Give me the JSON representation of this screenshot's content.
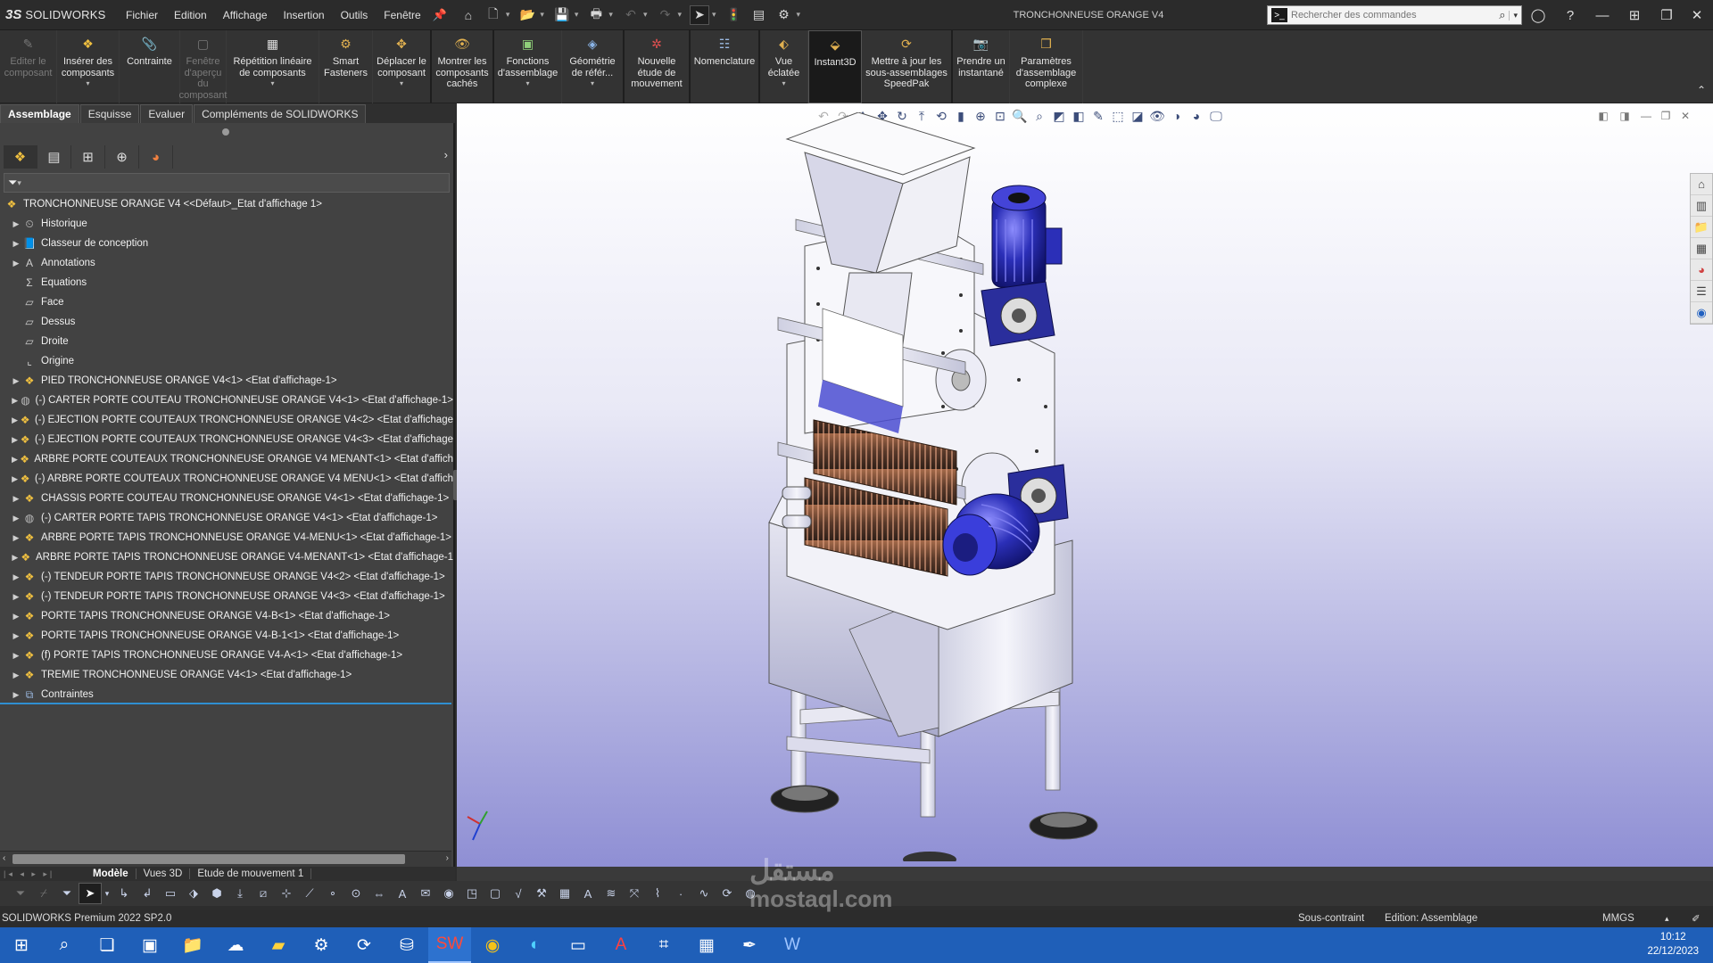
{
  "app": {
    "logo_mark": "3S",
    "logo_text": "SOLIDWORKS",
    "document_title": "TRONCHONNEUSE ORANGE V4"
  },
  "menu": [
    "Fichier",
    "Edition",
    "Affichage",
    "Insertion",
    "Outils",
    "Fenêtre"
  ],
  "search": {
    "placeholder": "Rechercher des commandes"
  },
  "ribbon": {
    "commands": [
      {
        "label": "Editer le composant",
        "icon": "edit-component-icon",
        "enabled": false
      },
      {
        "label": "Insérer des composants",
        "icon": "insert-components-icon",
        "enabled": true
      },
      {
        "label": "Contrainte",
        "icon": "mate-icon",
        "enabled": true
      },
      {
        "label": "Fenêtre d'aperçu du composant",
        "icon": "preview-window-icon",
        "enabled": false
      },
      {
        "label": "Répétition linéaire de composants",
        "icon": "linear-pattern-icon",
        "enabled": true
      },
      {
        "label": "Smart Fasteners",
        "icon": "smart-fasteners-icon",
        "enabled": true
      },
      {
        "label": "Déplacer le composant",
        "icon": "move-component-icon",
        "enabled": true
      },
      {
        "label": "Montrer les composants cachés",
        "icon": "show-hidden-icon",
        "enabled": true
      },
      {
        "label": "Fonctions d'assemblage",
        "icon": "assembly-features-icon",
        "enabled": true
      },
      {
        "label": "Géométrie de référ...",
        "icon": "reference-geometry-icon",
        "enabled": true
      },
      {
        "label": "Nouvelle étude de mouvement",
        "icon": "motion-study-icon",
        "enabled": true
      },
      {
        "label": "Nomenclature",
        "icon": "bom-icon",
        "enabled": true
      },
      {
        "label": "Vue éclatée",
        "icon": "exploded-view-icon",
        "enabled": true
      },
      {
        "label": "Instant3D",
        "icon": "instant3d-icon",
        "enabled": true,
        "active": true
      },
      {
        "label": "Mettre à jour les sous-assemblages SpeedPak",
        "icon": "speedpak-icon",
        "enabled": true
      },
      {
        "label": "Prendre un instantané",
        "icon": "snapshot-icon",
        "enabled": true
      },
      {
        "label": "Paramètres d'assemblage complexe",
        "icon": "large-assembly-icon",
        "enabled": true
      }
    ]
  },
  "tabs": [
    "Assemblage",
    "Esquisse",
    "Evaluer",
    "Compléments de SOLIDWORKS"
  ],
  "tree": {
    "root": "TRONCHONNEUSE ORANGE V4 <<Défaut>_Etat d'affichage 1>",
    "items": [
      {
        "label": "Historique",
        "icon": "history-icon",
        "expandable": true
      },
      {
        "label": "Classeur de conception",
        "icon": "design-binder-icon",
        "expandable": true
      },
      {
        "label": "Annotations",
        "icon": "annotations-icon",
        "expandable": true
      },
      {
        "label": "Equations",
        "icon": "equations-icon",
        "expandable": false
      },
      {
        "label": "Face",
        "icon": "plane-icon",
        "expandable": false
      },
      {
        "label": "Dessus",
        "icon": "plane-icon",
        "expandable": false
      },
      {
        "label": "Droite",
        "icon": "plane-icon",
        "expandable": false
      },
      {
        "label": "Origine",
        "icon": "origin-icon",
        "expandable": false
      },
      {
        "label": "PIED TRONCHONNEUSE ORANGE V4<1>  <Etat d'affichage-1>",
        "icon": "part-icon",
        "expandable": true
      },
      {
        "label": "(-) CARTER PORTE COUTEAU TRONCHONNEUSE ORANGE V4<1>  <Etat d'affichage-1>",
        "icon": "part-gray-icon",
        "expandable": true
      },
      {
        "label": "(-) EJECTION PORTE COUTEAUX TRONCHONNEUSE ORANGE V4<2>  <Etat d'affichage",
        "icon": "part-icon",
        "expandable": true
      },
      {
        "label": "(-) EJECTION PORTE COUTEAUX TRONCHONNEUSE ORANGE V4<3>  <Etat d'affichage",
        "icon": "part-icon",
        "expandable": true
      },
      {
        "label": "ARBRE PORTE COUTEAUX TRONCHONNEUSE ORANGE V4 MENANT<1>  <Etat d'affich",
        "icon": "part-icon",
        "expandable": true
      },
      {
        "label": "(-) ARBRE PORTE COUTEAUX TRONCHONNEUSE ORANGE V4 MENU<1>  <Etat d'affich",
        "icon": "part-icon",
        "expandable": true
      },
      {
        "label": "CHASSIS PORTE COUTEAU TRONCHONNEUSE ORANGE V4<1>  <Etat d'affichage-1>",
        "icon": "part-icon",
        "expandable": true
      },
      {
        "label": "(-) CARTER  PORTE TAPIS TRONCHONNEUSE ORANGE V4<1>  <Etat d'affichage-1>",
        "icon": "part-gray-icon",
        "expandable": true
      },
      {
        "label": "ARBRE  PORTE TAPIS TRONCHONNEUSE ORANGE V4-MENU<1>  <Etat d'affichage-1>",
        "icon": "part-icon",
        "expandable": true
      },
      {
        "label": "ARBRE PORTE TAPIS TRONCHONNEUSE ORANGE V4-MENANT<1>  <Etat d'affichage-1",
        "icon": "part-icon",
        "expandable": true
      },
      {
        "label": "(-) TENDEUR PORTE TAPIS TRONCHONNEUSE ORANGE V4<2>  <Etat d'affichage-1>",
        "icon": "part-icon",
        "expandable": true
      },
      {
        "label": "(-) TENDEUR PORTE TAPIS TRONCHONNEUSE ORANGE V4<3>  <Etat d'affichage-1>",
        "icon": "part-icon",
        "expandable": true
      },
      {
        "label": "PORTE TAPIS  TRONCHONNEUSE ORANGE V4-B<1>  <Etat d'affichage-1>",
        "icon": "part-icon",
        "expandable": true
      },
      {
        "label": "PORTE TAPIS TRONCHONNEUSE ORANGE V4-B-1<1>  <Etat d'affichage-1>",
        "icon": "part-icon",
        "expandable": true
      },
      {
        "label": "(f) PORTE TAPIS  TRONCHONNEUSE ORANGE V4-A<1>  <Etat d'affichage-1>",
        "icon": "part-icon",
        "expandable": true
      },
      {
        "label": "TREMIE TRONCHONNEUSE ORANGE V4<1>  <Etat d'affichage-1>",
        "icon": "part-icon",
        "expandable": true
      },
      {
        "label": "Contraintes",
        "icon": "mates-folder-icon",
        "expandable": true
      }
    ]
  },
  "model_tabs": [
    "Modèle",
    "Vues 3D",
    "Etude de mouvement 1"
  ],
  "status": {
    "product": "SOLIDWORKS Premium 2022 SP2.0",
    "constraint": "Sous-contraint",
    "editing": "Edition: Assemblage",
    "units": "MMGS"
  },
  "clock": {
    "time": "10:12",
    "date": "22/12/2023"
  },
  "watermark": {
    "arabic": "مستقل",
    "latin": "mostaql.com"
  },
  "colors": {
    "accent": "#2f8fd1",
    "taskbar": "#1f5fb8",
    "motor_blue": "#2b2fb8",
    "frame": "#f2f2f8"
  }
}
